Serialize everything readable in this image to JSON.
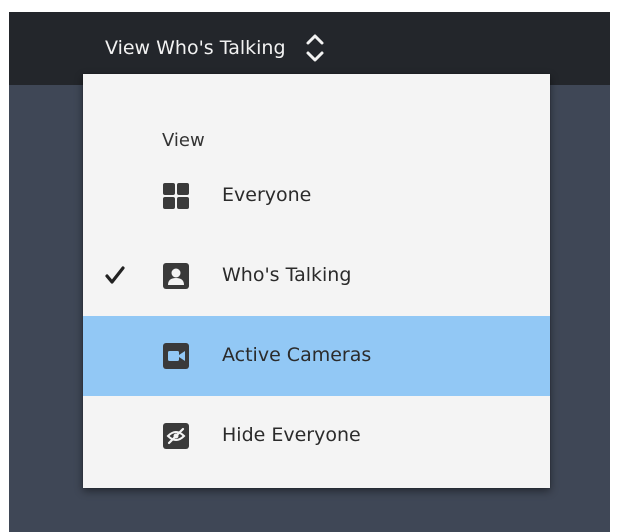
{
  "topbar": {
    "view_label": "View Who's Talking"
  },
  "menu": {
    "header": "View",
    "items": [
      {
        "label": "Everyone",
        "icon": "grid-icon",
        "checked": false,
        "highlighted": false
      },
      {
        "label": "Who's Talking",
        "icon": "person-icon",
        "checked": true,
        "highlighted": false
      },
      {
        "label": "Active Cameras",
        "icon": "camera-icon",
        "checked": false,
        "highlighted": true
      },
      {
        "label": "Hide Everyone",
        "icon": "eye-slash-icon",
        "checked": false,
        "highlighted": false
      }
    ]
  },
  "colors": {
    "topbar_bg": "#23262b",
    "panel_bg": "#3f4756",
    "menu_bg": "#f4f4f4",
    "highlight_bg": "#92c8f5",
    "icon_color": "#3a3a3a"
  }
}
